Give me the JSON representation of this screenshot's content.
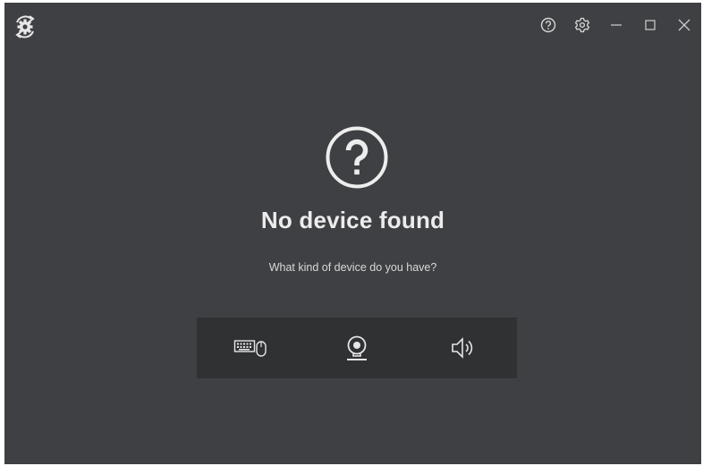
{
  "colors": {
    "window_bg": "#3f4043",
    "panel_bg": "#303133",
    "foreground": "#e6e6e6"
  },
  "titlebar": {
    "logo_icon": "gear-sync-icon",
    "controls": [
      {
        "name": "help",
        "icon": "help-circle-icon"
      },
      {
        "name": "settings",
        "icon": "gear-icon"
      },
      {
        "name": "minimize",
        "icon": "minimize-icon"
      },
      {
        "name": "maximize",
        "icon": "maximize-icon"
      },
      {
        "name": "close",
        "icon": "close-icon"
      }
    ]
  },
  "main": {
    "hero_icon": "question-circle-icon",
    "headline": "No device found",
    "subline": "What kind of device do you have?",
    "device_options": [
      {
        "name": "keyboard-mouse",
        "icon": "keyboard-mouse-icon"
      },
      {
        "name": "webcam",
        "icon": "webcam-icon"
      },
      {
        "name": "speaker",
        "icon": "speaker-icon"
      }
    ]
  }
}
